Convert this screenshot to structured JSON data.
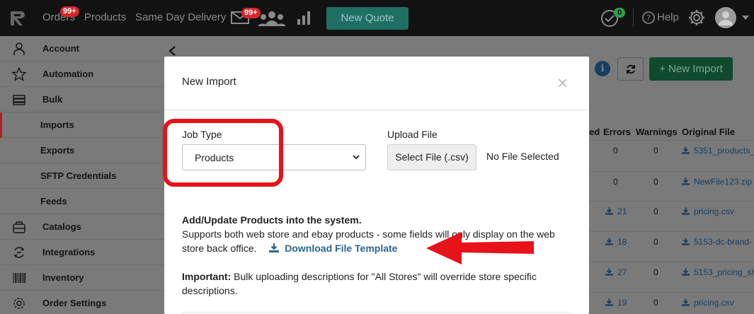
{
  "topnav": {
    "orders_label": "Orders",
    "orders_badge": "99+",
    "products_label": "Products",
    "same_day_label": "Same Day Delivery",
    "mail_badge": "99+",
    "new_quote_label": "New Quote",
    "tasks_badge": "0",
    "help_label": "Help"
  },
  "sidebar": {
    "items": [
      {
        "label": "Account",
        "icon": "user-icon"
      },
      {
        "label": "Automation",
        "icon": "star-icon"
      },
      {
        "label": "Bulk",
        "icon": "stack-icon"
      },
      {
        "label": "Imports"
      },
      {
        "label": "Exports"
      },
      {
        "label": "SFTP Credentials"
      },
      {
        "label": "Feeds"
      },
      {
        "label": "Catalogs",
        "icon": "catalog-icon"
      },
      {
        "label": "Integrations",
        "icon": "integrations-icon"
      },
      {
        "label": "Inventory",
        "icon": "barcode-icon"
      },
      {
        "label": "Order Settings",
        "icon": "gear-icon"
      }
    ]
  },
  "page": {
    "new_import_label": "+ New Import",
    "columns": {
      "ed": "ed",
      "errors": "Errors",
      "warnings": "Warnings",
      "original_file": "Original File"
    },
    "rows": [
      {
        "added": "",
        "errors": "0",
        "warnings": "0",
        "file": "5351_products_"
      },
      {
        "added": "",
        "errors": "0",
        "warnings": "0",
        "file": "NewFile123.zip"
      },
      {
        "added": "21",
        "errors": "",
        "warnings": "0",
        "file": "pricing.csv"
      },
      {
        "added": "18",
        "errors": "",
        "warnings": "0",
        "file": "5153-dc-brand-"
      },
      {
        "added": "27",
        "errors": "",
        "warnings": "0",
        "file": "5153_pricing_sh"
      },
      {
        "added": "19",
        "errors": "",
        "warnings": "0",
        "file": "pricing.csv"
      }
    ]
  },
  "modal": {
    "title": "New Import",
    "close": "×",
    "job_type_label": "Job Type",
    "job_type_value": "Products",
    "upload_label": "Upload File",
    "select_file_label": "Select File (.csv)",
    "no_file_label": "No File Selected",
    "desc_heading": "Add/Update Products into the system.",
    "desc_body": "Supports both web store and ebay products - some fields will only display on the web store back office.",
    "download_label": "Download File Template",
    "important_label": "Important:",
    "important_body": "Bulk uploading descriptions for \"All Stores\" will override store specific descriptions."
  },
  "colors": {
    "annotation_red": "#e8121a",
    "primary_green": "#1e6f64",
    "link_blue": "#2a6496"
  }
}
